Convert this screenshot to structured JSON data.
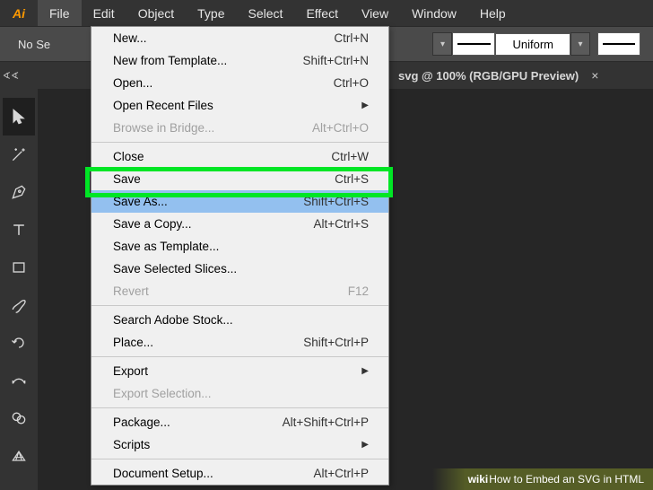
{
  "app": {
    "icon_label": "Ai"
  },
  "menubar": {
    "items": [
      "File",
      "Edit",
      "Object",
      "Type",
      "Select",
      "Effect",
      "View",
      "Window",
      "Help"
    ],
    "active_index": 0
  },
  "controlbar": {
    "no_selection": "No Se",
    "uniform": "Uniform"
  },
  "tab": {
    "label": "svg @ 100% (RGB/GPU Preview)",
    "close": "×"
  },
  "dropdown": {
    "groups": [
      [
        {
          "label": "New...",
          "shortcut": "Ctrl+N",
          "disabled": false
        },
        {
          "label": "New from Template...",
          "shortcut": "Shift+Ctrl+N",
          "disabled": false
        },
        {
          "label": "Open...",
          "shortcut": "Ctrl+O",
          "disabled": false
        },
        {
          "label": "Open Recent Files",
          "shortcut": "",
          "submenu": true,
          "disabled": false
        },
        {
          "label": "Browse in Bridge...",
          "shortcut": "Alt+Ctrl+O",
          "disabled": true
        }
      ],
      [
        {
          "label": "Close",
          "shortcut": "Ctrl+W",
          "disabled": false
        },
        {
          "label": "Save",
          "shortcut": "Ctrl+S",
          "disabled": false
        },
        {
          "label": "Save As...",
          "shortcut": "Shift+Ctrl+S",
          "disabled": false,
          "highlighted": true
        },
        {
          "label": "Save a Copy...",
          "shortcut": "Alt+Ctrl+S",
          "disabled": false
        },
        {
          "label": "Save as Template...",
          "shortcut": "",
          "disabled": false
        },
        {
          "label": "Save Selected Slices...",
          "shortcut": "",
          "disabled": false
        },
        {
          "label": "Revert",
          "shortcut": "F12",
          "disabled": true
        }
      ],
      [
        {
          "label": "Search Adobe Stock...",
          "shortcut": "",
          "disabled": false
        },
        {
          "label": "Place...",
          "shortcut": "Shift+Ctrl+P",
          "disabled": false
        }
      ],
      [
        {
          "label": "Export",
          "shortcut": "",
          "submenu": true,
          "disabled": false
        },
        {
          "label": "Export Selection...",
          "shortcut": "",
          "disabled": true
        }
      ],
      [
        {
          "label": "Package...",
          "shortcut": "Alt+Shift+Ctrl+P",
          "disabled": false
        },
        {
          "label": "Scripts",
          "shortcut": "",
          "submenu": true,
          "disabled": false
        }
      ],
      [
        {
          "label": "Document Setup...",
          "shortcut": "Alt+Ctrl+P",
          "disabled": false
        }
      ]
    ]
  },
  "watermark": {
    "brand": "wiki",
    "text": "How to Embed an SVG in HTML"
  }
}
